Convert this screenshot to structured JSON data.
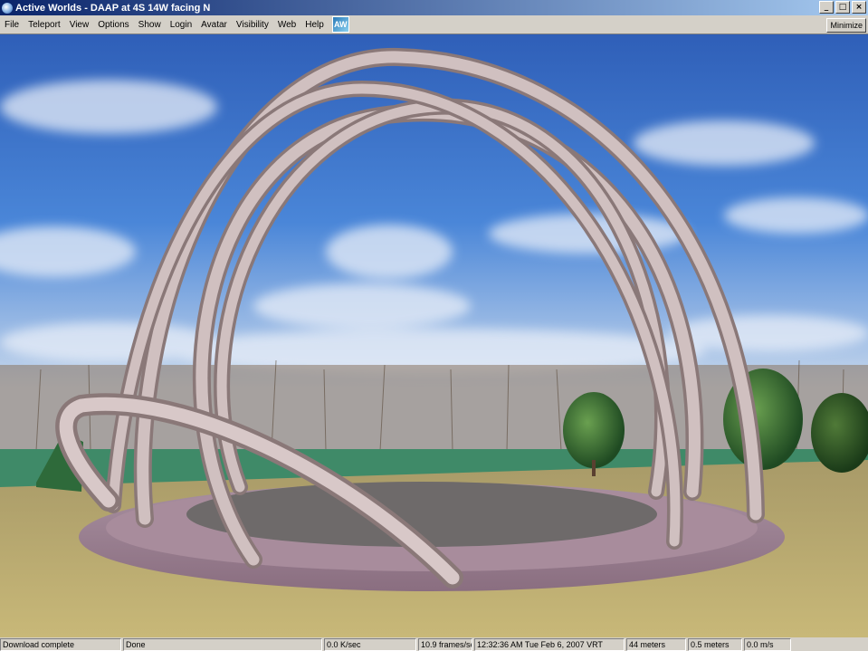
{
  "window": {
    "title": "Active Worlds - DAAP at 4S 14W facing N",
    "icon": "globe-icon",
    "buttons": {
      "minimize": "_",
      "maximize": "□",
      "close": "×"
    }
  },
  "menu": {
    "items": [
      {
        "label": "File"
      },
      {
        "label": "Teleport"
      },
      {
        "label": "View"
      },
      {
        "label": "Options"
      },
      {
        "label": "Show"
      },
      {
        "label": "Login"
      },
      {
        "label": "Avatar"
      },
      {
        "label": "Visibility"
      },
      {
        "label": "Web"
      },
      {
        "label": "Help"
      }
    ],
    "logo": "AW",
    "minimize_label": "Minimize"
  },
  "scene": {
    "description_icon": "3d-world-view"
  },
  "status": {
    "download": "Download complete",
    "state": "Done",
    "rate": "0.0 K/sec",
    "fps": "10.9 frames/sec",
    "clock": "12:32:36 AM Tue Feb 6, 2007 VRT",
    "distance": "44 meters",
    "step": "0.5 meters",
    "speed": "0.0 m/s"
  },
  "colors": {
    "title_start": "#0a246a",
    "title_end": "#a6caf0",
    "sky": "#3a70c8",
    "grass": "#3f8a68",
    "ground": "#b8a870",
    "arch": "#c8b8b8",
    "platform": "#b89aa8"
  }
}
